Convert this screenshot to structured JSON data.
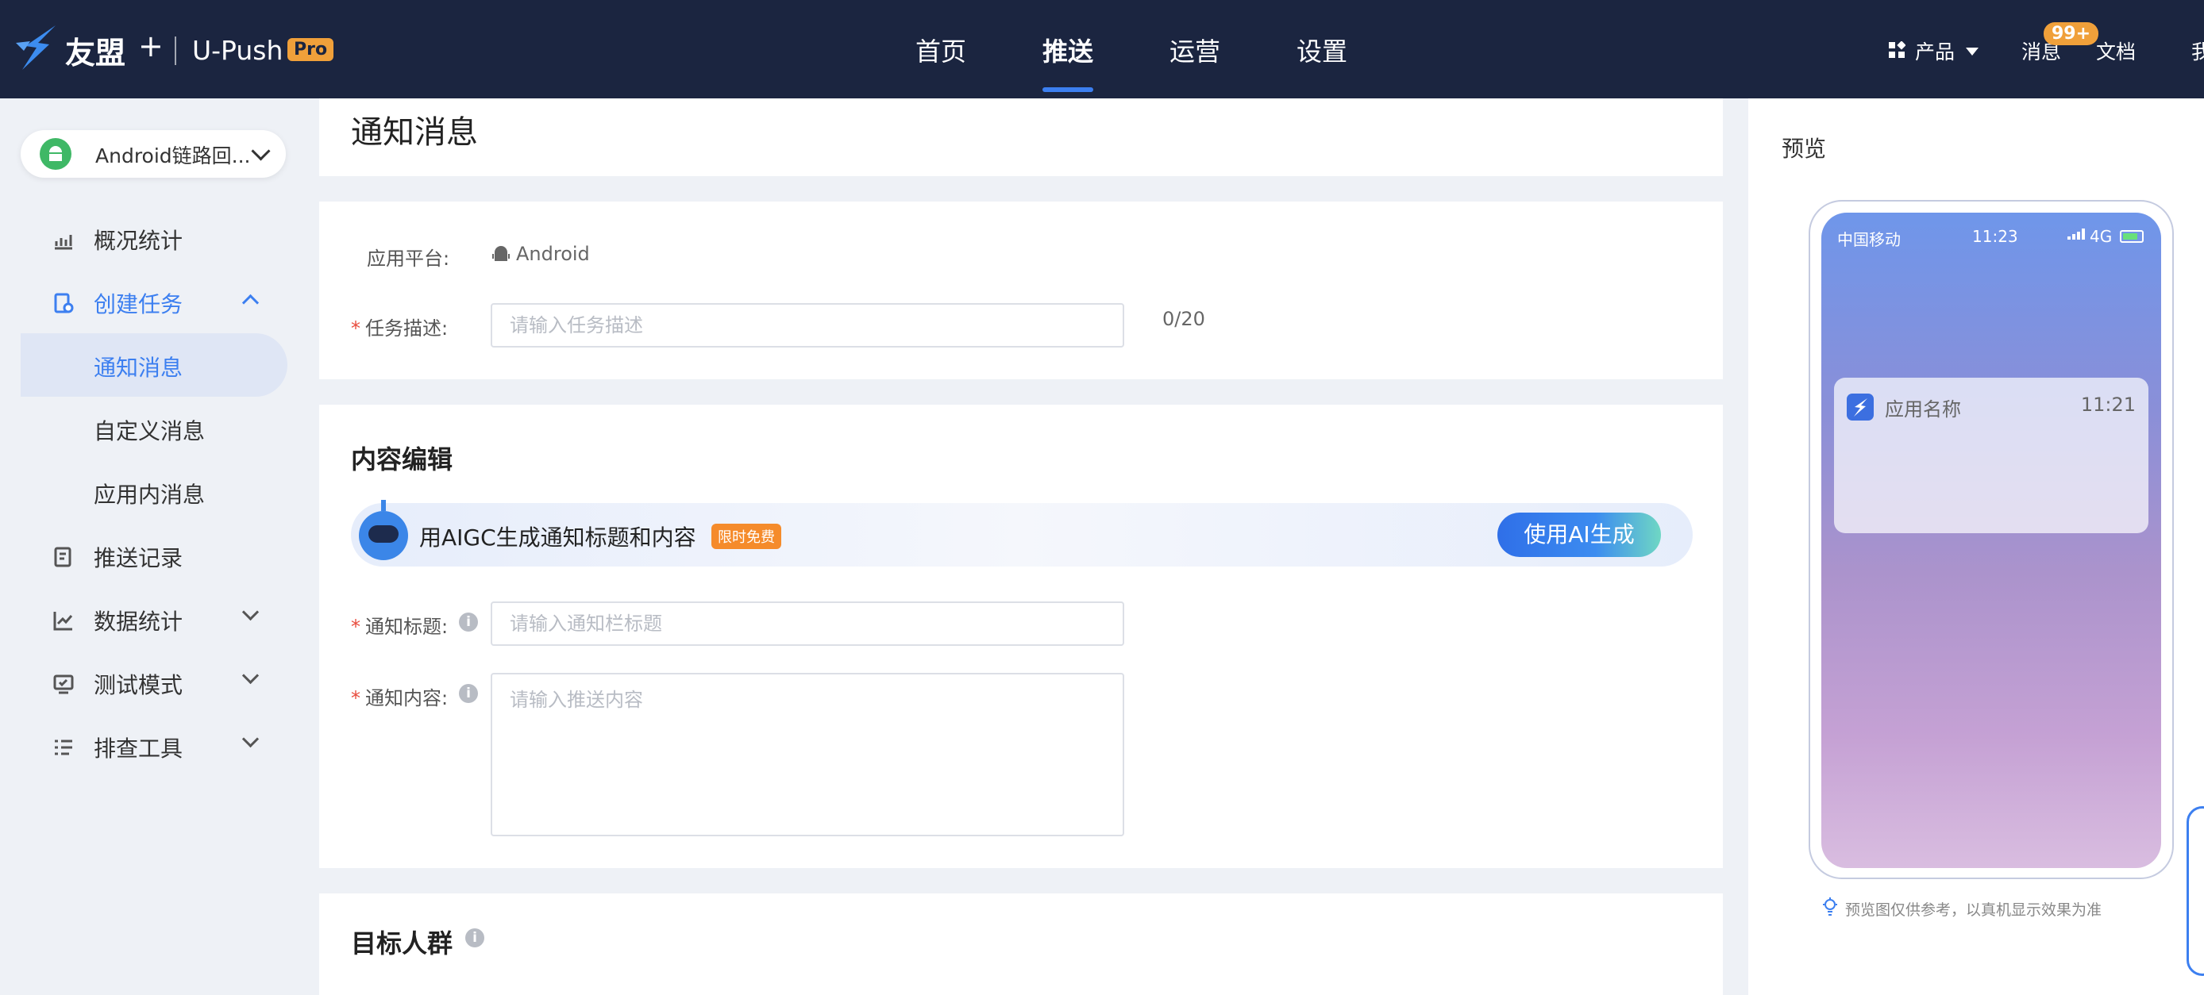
{
  "topbar": {
    "logo_text": "友盟",
    "logo_plus": "+",
    "product_name": "U-Push",
    "pro_badge": "Pro",
    "nav": [
      "首页",
      "推送",
      "运营",
      "设置"
    ],
    "active_nav": "推送",
    "products_label": "产品",
    "messages_label": "消息",
    "messages_badge": "99+",
    "docs_label": "文档",
    "truncated_item": "我"
  },
  "sidebar": {
    "app_selector": "Android链路回...",
    "items": [
      {
        "label": "概况统计",
        "icon": "chart-icon"
      },
      {
        "label": "创建任务",
        "icon": "task-icon",
        "expanded": true
      },
      {
        "label": "通知消息",
        "sub": true,
        "active": true
      },
      {
        "label": "自定义消息",
        "sub": true
      },
      {
        "label": "应用内消息",
        "sub": true
      },
      {
        "label": "推送记录",
        "icon": "record-icon"
      },
      {
        "label": "数据统计",
        "icon": "line-chart-icon",
        "collapsible": true
      },
      {
        "label": "测试模式",
        "icon": "test-icon",
        "collapsible": true
      },
      {
        "label": "排查工具",
        "icon": "tools-icon",
        "collapsible": true
      }
    ]
  },
  "main": {
    "page_title": "通知消息",
    "platform_label": "应用平台:",
    "platform_value": "Android",
    "task_desc_label": "任务描述:",
    "task_desc_placeholder": "请输入任务描述",
    "task_desc_counter": "0/20",
    "content_section_title": "内容编辑",
    "aigc_text": "用AIGC生成通知标题和内容",
    "aigc_tag": "限时免费",
    "aigc_button": "使用AI生成",
    "title_label": "通知标题:",
    "title_placeholder": "请输入通知栏标题",
    "content_label": "通知内容:",
    "content_placeholder": "请输入推送内容",
    "target_section_title": "目标人群"
  },
  "preview": {
    "title": "预览",
    "carrier": "中国移动",
    "status_time": "11:23",
    "network": "4G",
    "notif_app_name": "应用名称",
    "notif_time": "11:21",
    "note": "预览图仅供参考，以真机显示效果为准"
  },
  "colors": {
    "topbar_bg": "#1b2540",
    "accent": "#3c7ff0",
    "badge_orange": "#f0a03a",
    "required_red": "#e84c3d"
  }
}
